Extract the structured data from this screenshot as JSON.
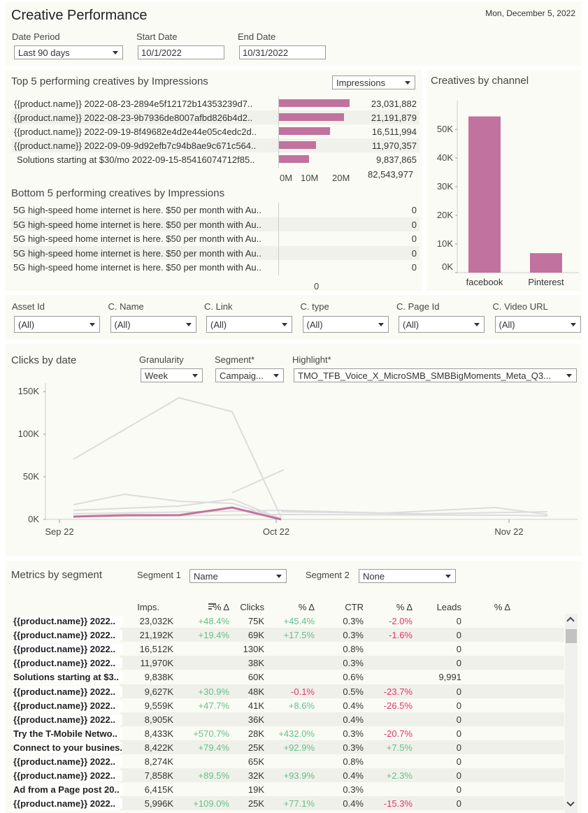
{
  "header": {
    "title": "Creative Performance",
    "date": "Mon, December 5, 2022",
    "date_period_label": "Date Period",
    "date_period_value": "Last 90 days",
    "start_label": "Start Date",
    "start_value": "10/1/2022",
    "end_label": "End Date",
    "end_value": "10/31/2022"
  },
  "top5": {
    "title": "Top 5 performing creatives by Impressions",
    "measure": "Impressions",
    "rows": [
      {
        "name": "{{product.name}} 2022-08-23-2894e5f12172b14353239d7..",
        "value": "23,031,882",
        "num": 23031882
      },
      {
        "name": "{{product.name}} 2022-08-23-9b7936de8007afbd826b4d2..",
        "value": "21,191,879",
        "num": 21191879
      },
      {
        "name": "{{product.name}} 2022-09-19-8f49682e4d2e44e05c4edc2d..",
        "value": "16,511,994",
        "num": 16511994
      },
      {
        "name": "{{product.name}} 2022-09-09-9d92efb7c94b8ae9c671c564..",
        "value": "11,970,357",
        "num": 11970357
      },
      {
        "name": "Solutions starting at $30/mo 2022-09-15-85416074712f85..",
        "value": "9,837,865",
        "num": 9837865
      }
    ],
    "total": "82,543,977",
    "axis": [
      "0M",
      "10M",
      "20M"
    ]
  },
  "bottom5": {
    "title": "Bottom 5 performing creatives by Impressions",
    "rows": [
      {
        "name": "5G high-speed home internet is here. $50 per month with Au..",
        "value": "0"
      },
      {
        "name": "5G high-speed home internet is here. $50 per month with Au..",
        "value": "0"
      },
      {
        "name": "5G high-speed home internet is here. $50 per month with Au..",
        "value": "0"
      },
      {
        "name": "5G high-speed home internet is here. $50 per month with Au..",
        "value": "0"
      },
      {
        "name": "5G high-speed home internet is here. $50 per month with Au..",
        "value": "0"
      }
    ],
    "axis_zero": "0"
  },
  "channel": {
    "title": "Creatives by channel",
    "yticks": [
      "50K",
      "40K",
      "30K",
      "20K",
      "10K",
      "0K"
    ],
    "chart_data": {
      "type": "bar",
      "categories": [
        "facebook",
        "Pinterest"
      ],
      "values": [
        54500,
        6800
      ],
      "ylim": [
        0,
        60000
      ]
    }
  },
  "filters": [
    {
      "label": "Asset Id",
      "value": "(All)"
    },
    {
      "label": "C. Name",
      "value": "(All)"
    },
    {
      "label": "C. Link",
      "value": "(All)"
    },
    {
      "label": "C. type",
      "value": "(All)"
    },
    {
      "label": "C. Page Id",
      "value": "(All)"
    },
    {
      "label": "C. Video URL",
      "value": "(All)"
    }
  ],
  "clicks": {
    "title": "Clicks by date",
    "granularity_label": "Granularity",
    "granularity_value": "Week",
    "segment_label": "Segment*",
    "segment_value": "Campaig...",
    "highlight_label": "Highlight*",
    "highlight_value": "TMO_TFB_Voice_X_MicroSMB_SMBBigMoments_Meta_Q3...",
    "yticks": [
      "150K",
      "100K",
      "50K",
      "0K"
    ],
    "xticks": [
      "Sep 22",
      "Oct 22",
      "Nov 22"
    ]
  },
  "metrics": {
    "title": "Metrics by segment",
    "seg1_label": "Segment 1",
    "seg1_value": "Name",
    "seg2_label": "Segment 2",
    "seg2_value": "None",
    "columns": [
      "Imps.",
      "% Δ",
      "Clicks",
      "% Δ",
      "CTR",
      "% Δ",
      "Leads",
      "% Δ"
    ],
    "rows": [
      [
        "{{product.name}} 2022..",
        "23,032K",
        "+48.4%",
        "75K",
        "+45.4%",
        "0.3%",
        "-2.0%",
        "0",
        ""
      ],
      [
        "{{product.name}} 2022..",
        "21,192K",
        "+19.4%",
        "69K",
        "+17.5%",
        "0.3%",
        "-1.6%",
        "0",
        ""
      ],
      [
        "{{product.name}} 2022..",
        "16,512K",
        "",
        "130K",
        "",
        "0.8%",
        "",
        "0",
        ""
      ],
      [
        "{{product.name}} 2022..",
        "11,970K",
        "",
        "38K",
        "",
        "0.3%",
        "",
        "0",
        ""
      ],
      [
        "Solutions starting at $3..",
        "9,838K",
        "",
        "60K",
        "",
        "0.6%",
        "",
        "9,991",
        ""
      ],
      [
        "{{product.name}} 2022..",
        "9,627K",
        "+30.9%",
        "48K",
        "-0.1%",
        "0.5%",
        "-23.7%",
        "0",
        ""
      ],
      [
        "{{product.name}} 2022..",
        "9,559K",
        "+47.7%",
        "41K",
        "+8.6%",
        "0.4%",
        "-26.5%",
        "0",
        ""
      ],
      [
        "{{product.name}} 2022..",
        "8,905K",
        "",
        "36K",
        "",
        "0.4%",
        "",
        "0",
        ""
      ],
      [
        "Try the T-Mobile Netwo..",
        "8,433K",
        "+570.7%",
        "28K",
        "+432.0%",
        "0.3%",
        "-20.7%",
        "0",
        ""
      ],
      [
        "Connect to your busines..",
        "8,422K",
        "+79.4%",
        "25K",
        "+92.9%",
        "0.3%",
        "+7.5%",
        "0",
        ""
      ],
      [
        "{{product.name}} 2022..",
        "8,274K",
        "",
        "65K",
        "",
        "0.8%",
        "",
        "0",
        ""
      ],
      [
        "{{product.name}} 2022..",
        "7,858K",
        "+89.5%",
        "32K",
        "+93.9%",
        "0.4%",
        "+2.3%",
        "0",
        ""
      ],
      [
        "Ad from a Page post 20..",
        "6,415K",
        "",
        "19K",
        "",
        "0.3%",
        "",
        "0",
        ""
      ],
      [
        "{{product.name}} 2022..",
        "5,996K",
        "+109.0%",
        "25K",
        "+77.1%",
        "0.4%",
        "-15.3%",
        "0",
        ""
      ]
    ]
  }
}
